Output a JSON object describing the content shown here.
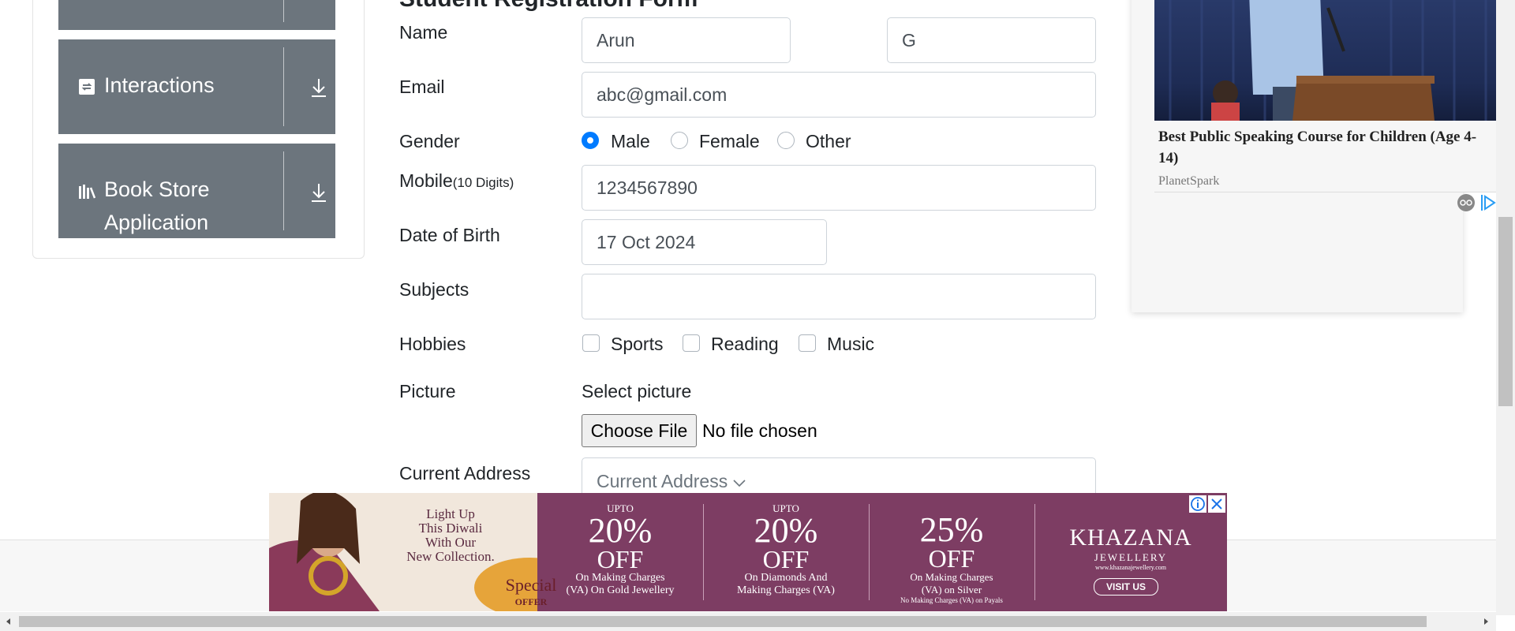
{
  "sidebar": {
    "items": [
      {
        "label": "Interactions"
      },
      {
        "label_line1": "Book Store",
        "label_line2": "Application"
      }
    ]
  },
  "form": {
    "title": "Student Registration Form",
    "name_label": "Name",
    "first_name": "Arun",
    "last_name": "G",
    "email_label": "Email",
    "email_value": "abc@gmail.com",
    "gender_label": "Gender",
    "gender_options": [
      "Male",
      "Female",
      "Other"
    ],
    "gender_selected": "Male",
    "mobile_label": "Mobile",
    "mobile_hint": "(10 Digits)",
    "mobile_value": "1234567890",
    "dob_label": "Date of Birth",
    "dob_value": "17 Oct 2024",
    "subjects_label": "Subjects",
    "subjects_value": "",
    "hobbies_label": "Hobbies",
    "hobbies": [
      "Sports",
      "Reading",
      "Music"
    ],
    "picture_label": "Picture",
    "select_picture": "Select picture",
    "choose_file": "Choose File",
    "no_file": "No file chosen",
    "address_label": "Current Address",
    "address_placeholder": "Current Address"
  },
  "ad_right": {
    "headline": "Best Public Speaking Course for Children (Age 4-14)",
    "advertiser": "PlanetSpark"
  },
  "banner": {
    "tagline_1": "Light Up",
    "tagline_2": "This Diwali",
    "tagline_3": "With Our",
    "tagline_4": "New Collection.",
    "special": "Special",
    "offer": "OFFER",
    "offers": [
      {
        "upto": "UPTO",
        "percent": "20%",
        "off": "OFF",
        "line1": "On Making Charges",
        "line2": "(VA) On Gold Jewellery"
      },
      {
        "upto": "UPTO",
        "percent": "20%",
        "off": "OFF",
        "line1": "On Diamonds And",
        "line2": "Making Charges (VA)"
      },
      {
        "upto": "",
        "percent": "25%",
        "off": "OFF",
        "line1": "On Making Charges",
        "line2": "(VA) on Silver"
      }
    ],
    "fine_print": "No Making Charges (VA) on Payals",
    "brand": "KHAZANA",
    "brand_sub": "JEWELLERY",
    "brand_url": "www.khazanajewellery.com",
    "visit": "VISIT US"
  },
  "colors": {
    "sidebar_bg": "#6c757d",
    "radio_checked": "#007bff",
    "banner_bg": "#7d3d63"
  }
}
